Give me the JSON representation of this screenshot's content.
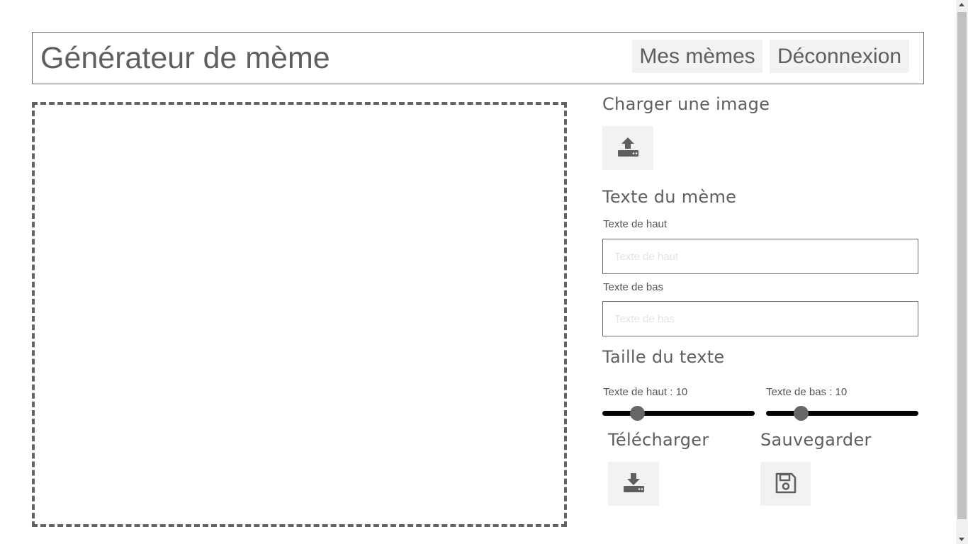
{
  "header": {
    "title": "Générateur de mème",
    "nav": {
      "my_memes": "Mes mèmes",
      "logout": "Déconnexion"
    }
  },
  "upload": {
    "title": "Charger une image",
    "icon": "upload-icon"
  },
  "meme_text": {
    "title": "Texte du mème",
    "top_label": "Texte de haut",
    "top_placeholder": "Texte de haut",
    "top_value": "",
    "bottom_label": "Texte de bas",
    "bottom_placeholder": "Texte de bas",
    "bottom_value": ""
  },
  "text_size": {
    "title": "Taille du texte",
    "top_label": "Texte de haut : 10",
    "top_value": 10,
    "bottom_label": "Texte de bas : 10",
    "bottom_value": 10,
    "slider_fraction": 0.2
  },
  "download": {
    "title": "Télécharger",
    "icon": "download-icon"
  },
  "save": {
    "title": "Sauvegarder",
    "icon": "floppy-disk-icon"
  },
  "colors": {
    "text": "#5f5f5f",
    "button_bg": "#f2f2f2",
    "border": "#6e6e6e",
    "slider_track": "#000000",
    "slider_thumb": "#666666"
  }
}
